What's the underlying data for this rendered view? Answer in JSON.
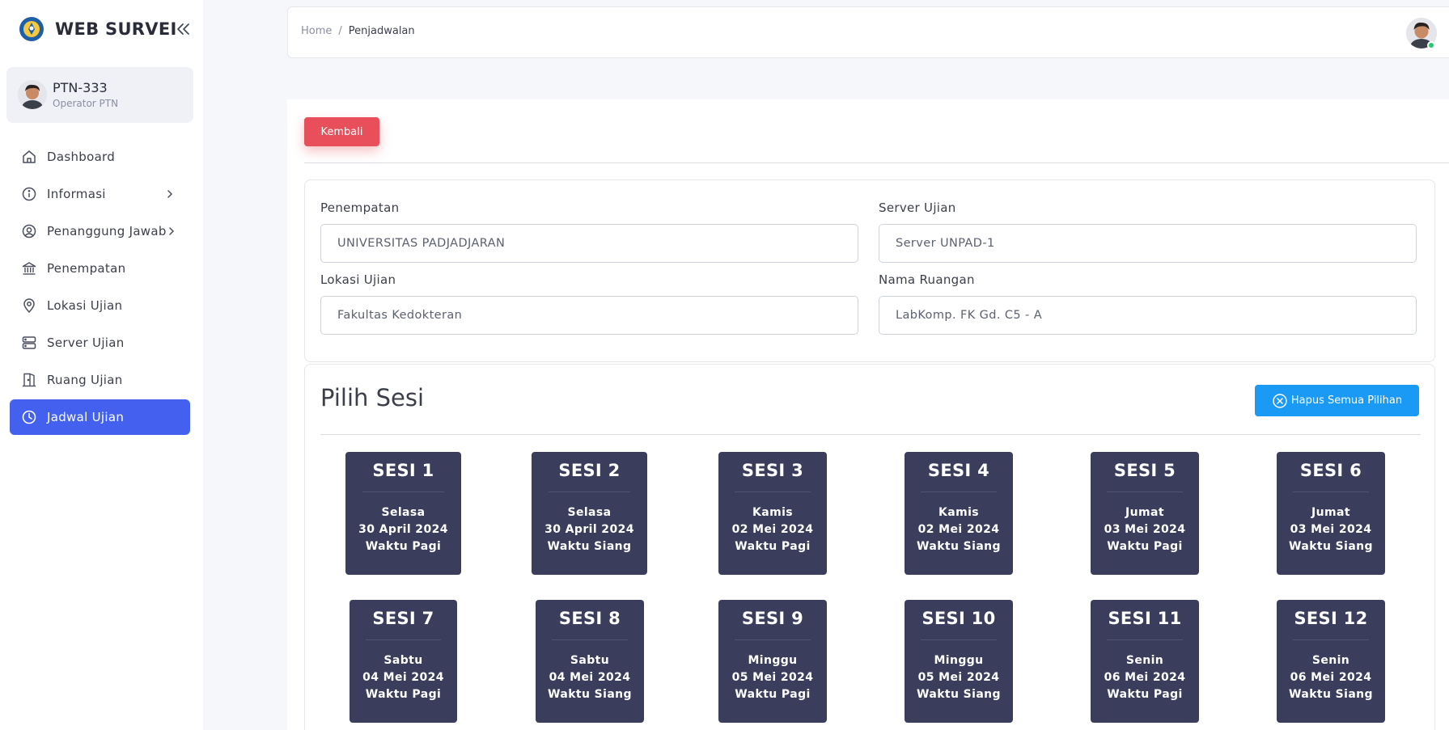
{
  "app": {
    "title": "WEB SURVEI"
  },
  "user": {
    "name": "PTN-333",
    "role": "Operator PTN"
  },
  "sidebar": {
    "items": [
      {
        "label": "Dashboard",
        "icon": "home-icon"
      },
      {
        "label": "Informasi",
        "icon": "info-icon",
        "has_submenu": true
      },
      {
        "label": "Penanggung Jawab",
        "icon": "user-circle-icon",
        "has_submenu": true
      },
      {
        "label": "Penempatan",
        "icon": "bank-icon"
      },
      {
        "label": "Lokasi Ujian",
        "icon": "map-pin-icon"
      },
      {
        "label": "Server Ujian",
        "icon": "server-icon"
      },
      {
        "label": "Ruang Ujian",
        "icon": "door-icon"
      },
      {
        "label": "Jadwal Ujian",
        "icon": "clock-icon",
        "active": true
      }
    ]
  },
  "breadcrumb": {
    "home": "Home",
    "separator": "/",
    "current": "Penjadwalan"
  },
  "actions": {
    "back_label": "Kembali",
    "clear_label": "Hapus Semua Pilihan"
  },
  "form": {
    "penempatan": {
      "label": "Penempatan",
      "value": "UNIVERSITAS PADJADJARAN"
    },
    "server": {
      "label": "Server Ujian",
      "value": "Server UNPAD-1"
    },
    "lokasi": {
      "label": "Lokasi Ujian",
      "value": "Fakultas Kedokteran"
    },
    "ruangan": {
      "label": "Nama Ruangan",
      "value": "LabKomp. FK Gd. C5 - A"
    }
  },
  "sesi_section": {
    "title": "Pilih Sesi"
  },
  "sessions": [
    {
      "name": "SESI 1",
      "day": "Selasa",
      "date": "30 April 2024",
      "time": "Waktu Pagi"
    },
    {
      "name": "SESI 2",
      "day": "Selasa",
      "date": "30 April 2024",
      "time": "Waktu Siang"
    },
    {
      "name": "SESI 3",
      "day": "Kamis",
      "date": "02 Mei 2024",
      "time": "Waktu Pagi"
    },
    {
      "name": "SESI 4",
      "day": "Kamis",
      "date": "02 Mei 2024",
      "time": "Waktu Siang"
    },
    {
      "name": "SESI 5",
      "day": "Jumat",
      "date": "03 Mei 2024",
      "time": "Waktu Pagi"
    },
    {
      "name": "SESI 6",
      "day": "Jumat",
      "date": "03 Mei 2024",
      "time": "Waktu Siang"
    },
    {
      "name": "SESI 7",
      "day": "Sabtu",
      "date": "04 Mei 2024",
      "time": "Waktu Pagi"
    },
    {
      "name": "SESI 8",
      "day": "Sabtu",
      "date": "04 Mei 2024",
      "time": "Waktu Siang"
    },
    {
      "name": "SESI 9",
      "day": "Minggu",
      "date": "05 Mei 2024",
      "time": "Waktu Pagi"
    },
    {
      "name": "SESI 10",
      "day": "Minggu",
      "date": "05 Mei 2024",
      "time": "Waktu Siang"
    },
    {
      "name": "SESI 11",
      "day": "Senin",
      "date": "06 Mei 2024",
      "time": "Waktu Pagi"
    },
    {
      "name": "SESI 12",
      "day": "Senin",
      "date": "06 Mei 2024",
      "time": "Waktu Siang"
    }
  ],
  "colors": {
    "primary": "#4361ee",
    "danger": "#e94f5a",
    "info": "#1b9af5",
    "session_bg": "#3a3e5c",
    "online": "#28c76f"
  }
}
